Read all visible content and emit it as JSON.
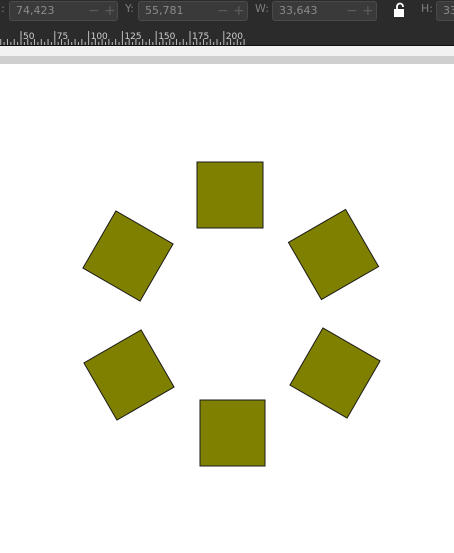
{
  "toolbar": {
    "x_label": ":",
    "x_value": "74,423",
    "y_label": "Y:",
    "y_value": "55,781",
    "w_label": "W:",
    "w_value": "33,643",
    "h_label": "H:",
    "h_value": "33",
    "minus_icon": "minus-icon",
    "plus_icon": "plus-icon",
    "lock_icon": "lock-icon"
  },
  "ruler": {
    "ticks": [
      "50",
      "75",
      "100",
      "125",
      "150",
      "175",
      "200"
    ]
  },
  "canvas": {
    "shape_fill": "#808000",
    "shape_stroke": "#1a1a1a",
    "shapes": [
      "square-top",
      "square-upper-right",
      "square-lower-right",
      "square-bottom",
      "square-lower-left",
      "square-upper-left"
    ]
  }
}
